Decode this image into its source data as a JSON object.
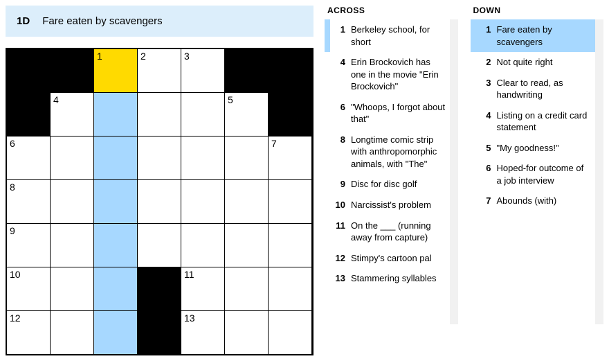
{
  "current_clue": {
    "id": "1D",
    "text": "Fare eaten by scavengers"
  },
  "headings": {
    "across": "ACROSS",
    "down": "DOWN"
  },
  "grid": {
    "cols": 7,
    "rows": 7
  },
  "cells": [
    {
      "r": 0,
      "c": 0,
      "black": true
    },
    {
      "r": 0,
      "c": 1,
      "black": true
    },
    {
      "r": 0,
      "c": 2,
      "num": "1",
      "state": "active"
    },
    {
      "r": 0,
      "c": 3,
      "num": "2"
    },
    {
      "r": 0,
      "c": 4,
      "num": "3"
    },
    {
      "r": 0,
      "c": 5,
      "black": true
    },
    {
      "r": 0,
      "c": 6,
      "black": true
    },
    {
      "r": 1,
      "c": 0,
      "black": true
    },
    {
      "r": 1,
      "c": 1,
      "num": "4"
    },
    {
      "r": 1,
      "c": 2,
      "state": "highlight"
    },
    {
      "r": 1,
      "c": 3
    },
    {
      "r": 1,
      "c": 4
    },
    {
      "r": 1,
      "c": 5,
      "num": "5"
    },
    {
      "r": 1,
      "c": 6,
      "black": true
    },
    {
      "r": 2,
      "c": 0,
      "num": "6"
    },
    {
      "r": 2,
      "c": 1
    },
    {
      "r": 2,
      "c": 2,
      "state": "highlight"
    },
    {
      "r": 2,
      "c": 3
    },
    {
      "r": 2,
      "c": 4
    },
    {
      "r": 2,
      "c": 5
    },
    {
      "r": 2,
      "c": 6,
      "num": "7"
    },
    {
      "r": 3,
      "c": 0,
      "num": "8"
    },
    {
      "r": 3,
      "c": 1
    },
    {
      "r": 3,
      "c": 2,
      "state": "highlight"
    },
    {
      "r": 3,
      "c": 3
    },
    {
      "r": 3,
      "c": 4
    },
    {
      "r": 3,
      "c": 5
    },
    {
      "r": 3,
      "c": 6
    },
    {
      "r": 4,
      "c": 0,
      "num": "9"
    },
    {
      "r": 4,
      "c": 1
    },
    {
      "r": 4,
      "c": 2,
      "state": "highlight"
    },
    {
      "r": 4,
      "c": 3
    },
    {
      "r": 4,
      "c": 4
    },
    {
      "r": 4,
      "c": 5
    },
    {
      "r": 4,
      "c": 6
    },
    {
      "r": 5,
      "c": 0,
      "num": "10"
    },
    {
      "r": 5,
      "c": 1
    },
    {
      "r": 5,
      "c": 2,
      "state": "highlight"
    },
    {
      "r": 5,
      "c": 3,
      "black": true
    },
    {
      "r": 5,
      "c": 4,
      "num": "11"
    },
    {
      "r": 5,
      "c": 5
    },
    {
      "r": 5,
      "c": 6
    },
    {
      "r": 6,
      "c": 0,
      "num": "12"
    },
    {
      "r": 6,
      "c": 1
    },
    {
      "r": 6,
      "c": 2,
      "state": "highlight"
    },
    {
      "r": 6,
      "c": 3,
      "black": true
    },
    {
      "r": 6,
      "c": 4,
      "num": "13"
    },
    {
      "r": 6,
      "c": 5
    },
    {
      "r": 6,
      "c": 6
    }
  ],
  "across": [
    {
      "n": "1",
      "t": "Berkeley school, for short",
      "related": true
    },
    {
      "n": "4",
      "t": "Erin Brockovich has one in the movie \"Erin Brockovich\""
    },
    {
      "n": "6",
      "t": "\"Whoops, I forgot about that\""
    },
    {
      "n": "8",
      "t": "Longtime comic strip with anthropomorphic animals, with \"The\""
    },
    {
      "n": "9",
      "t": "Disc for disc golf"
    },
    {
      "n": "10",
      "t": "Narcissist's problem"
    },
    {
      "n": "11",
      "t": "On the ___ (running away from capture)"
    },
    {
      "n": "12",
      "t": "Stimpy's cartoon pal"
    },
    {
      "n": "13",
      "t": "Stammering syllables"
    }
  ],
  "down": [
    {
      "n": "1",
      "t": "Fare eaten by scavengers",
      "selected": true
    },
    {
      "n": "2",
      "t": "Not quite right"
    },
    {
      "n": "3",
      "t": "Clear to read, as handwriting"
    },
    {
      "n": "4",
      "t": "Listing on a credit card statement"
    },
    {
      "n": "5",
      "t": "\"My goodness!\""
    },
    {
      "n": "6",
      "t": "Hoped-for outcome of a job interview"
    },
    {
      "n": "7",
      "t": "Abounds (with)"
    }
  ]
}
